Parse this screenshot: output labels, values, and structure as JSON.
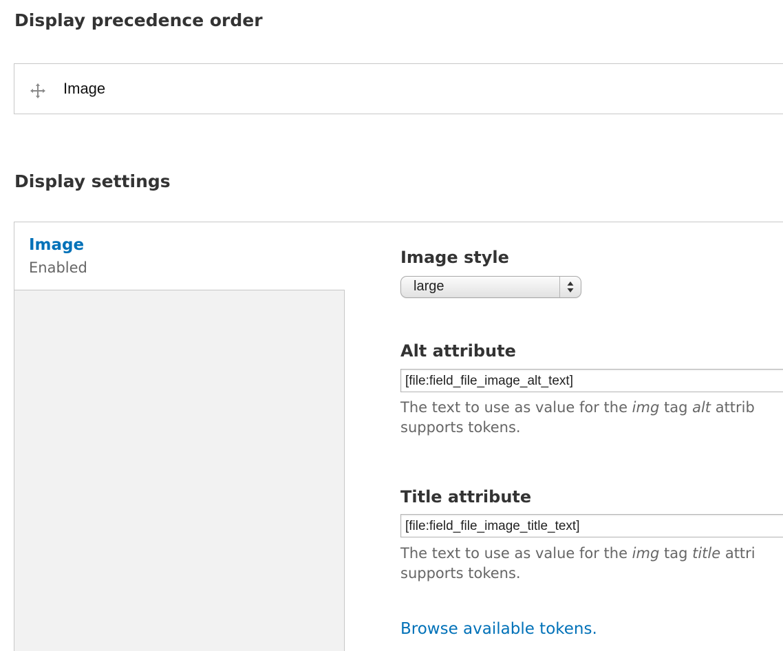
{
  "precedence": {
    "title": "Display precedence order",
    "rows": [
      {
        "label": "Image",
        "icon": "drag-handle-icon"
      }
    ]
  },
  "settings": {
    "title": "Display settings",
    "tab": {
      "title": "Image",
      "summary": "Enabled"
    },
    "image_style": {
      "label": "Image style",
      "selected": "large"
    },
    "alt": {
      "label": "Alt attribute",
      "value": "[file:field_file_image_alt_text]",
      "desc": {
        "part1": "The text to use as value for the ",
        "em1": "img",
        "part2": " tag ",
        "em2": "alt",
        "part3": " attrib",
        "line2": "supports tokens."
      }
    },
    "title_attr": {
      "label": "Title attribute",
      "value": "[file:field_file_image_title_text]",
      "desc": {
        "part1": "The text to use as value for the ",
        "em1": "img",
        "part2": " tag ",
        "em2": "title",
        "part3": " attri",
        "line2": "supports tokens."
      }
    },
    "tokens_link": "Browse available tokens."
  },
  "colors": {
    "link": "#0071b8",
    "heading": "#333333",
    "description": "#666666",
    "tab_menu_bg": "#f2f2f2",
    "border": "#c7c7c7"
  }
}
